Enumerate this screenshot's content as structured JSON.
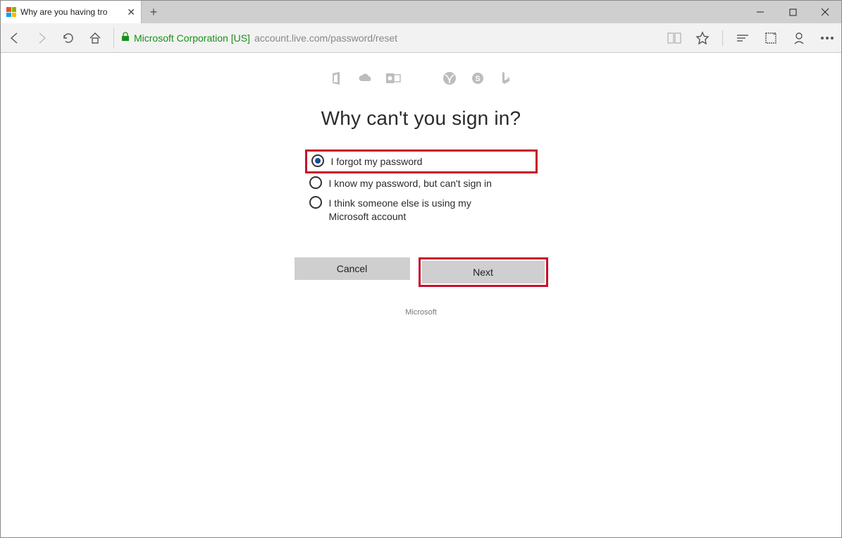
{
  "window": {
    "tab_title": "Why are you having tro"
  },
  "toolbar": {
    "certificate": "Microsoft Corporation [US]",
    "url": "account.live.com/password/reset"
  },
  "services": {
    "items": [
      "office-icon",
      "onedrive-icon",
      "outlook-icon",
      "microsoft-icon",
      "xbox-icon",
      "skype-icon",
      "bing-icon"
    ]
  },
  "page": {
    "heading": "Why can't you sign in?",
    "options": [
      {
        "label": "I forgot my password",
        "selected": true,
        "highlight": true
      },
      {
        "label": "I know my password, but can't sign in",
        "selected": false,
        "highlight": false
      },
      {
        "label": "I think someone else is using my Microsoft account",
        "selected": false,
        "highlight": false
      }
    ],
    "cancel_label": "Cancel",
    "next_label": "Next",
    "footer": "Microsoft"
  }
}
